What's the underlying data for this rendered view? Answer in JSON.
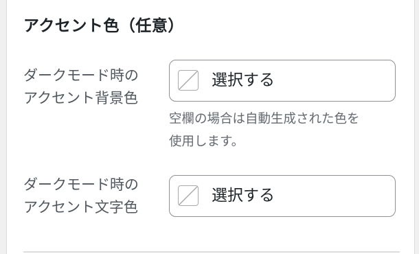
{
  "section": {
    "title": "アクセント色（任意）"
  },
  "rows": [
    {
      "label_line1": "ダークモード時の",
      "label_line2": "アクセント背景色",
      "button_label": "選択する",
      "help_line1": "空欄の場合は自動生成された色を",
      "help_line2": "使用します。"
    },
    {
      "label_line1": "ダークモード時の",
      "label_line2": "アクセント文字色",
      "button_label": "選択する"
    }
  ],
  "colors": {
    "text_primary": "#1d2327",
    "text_secondary": "#50575e",
    "help_text": "#646970",
    "border": "#8c8f94",
    "swatch_slash": "#a7aaad"
  },
  "icons": {
    "empty_swatch": "no-color-swatch-icon"
  }
}
